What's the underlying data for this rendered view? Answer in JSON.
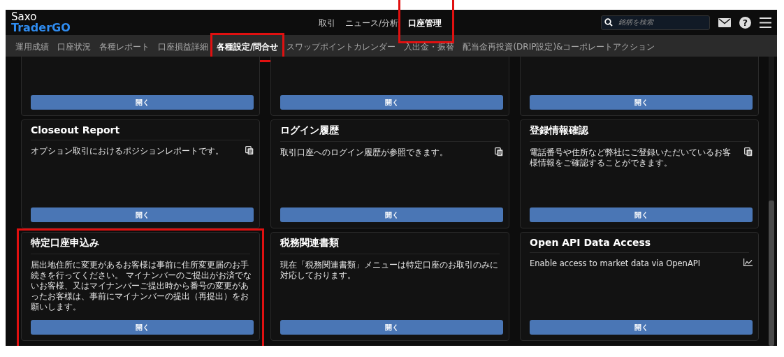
{
  "header": {
    "logo": {
      "line_1": "Saxo",
      "line_2": "TraderGO"
    },
    "nav": [
      {
        "label": "取引",
        "selected": false,
        "highlighted": false
      },
      {
        "label": "ニュース/分析",
        "selected": false,
        "highlighted": false
      },
      {
        "label": "口座管理",
        "selected": true,
        "highlighted": true
      }
    ],
    "search": {
      "placeholder": "銘柄を検索"
    },
    "help_label": "?"
  },
  "subnav": [
    {
      "label": "運用成績",
      "selected": false,
      "highlighted": false
    },
    {
      "label": "口座状況",
      "selected": false,
      "highlighted": false
    },
    {
      "label": "各種レポート",
      "selected": false,
      "highlighted": false
    },
    {
      "label": "口座損益詳細",
      "selected": false,
      "highlighted": false
    },
    {
      "label": "各種設定/問合せ",
      "selected": true,
      "highlighted": true
    },
    {
      "label": "スワップポイントカレンダー",
      "selected": false,
      "highlighted": false
    },
    {
      "label": "入出金・振替",
      "selected": false,
      "highlighted": false
    },
    {
      "label": "配当金再投資(DRIP設定)&コーポレートアクション",
      "selected": false,
      "highlighted": false
    }
  ],
  "cards": [
    {
      "kind": "partial",
      "button": "開く",
      "highlighted": false
    },
    {
      "kind": "partial",
      "button": "開く",
      "highlighted": false
    },
    {
      "kind": "partial",
      "button": "開く",
      "highlighted": false
    },
    {
      "kind": "document",
      "title": "Closeout Report",
      "description": "オプション取引におけるポジションレポートです。",
      "button": "開く",
      "highlighted": false
    },
    {
      "kind": "document",
      "title": "ログイン履歴",
      "description": "取引口座へのログイン履歴が参照できます。",
      "button": "開く",
      "highlighted": false
    },
    {
      "kind": "document",
      "title": "登録情報確認",
      "description": "電話番号や住所など弊社にご登録いただいているお客様情報をご確認することができます。",
      "button": "開く",
      "highlighted": false
    },
    {
      "kind": "plain",
      "title": "特定口座申込み",
      "description": "届出地住所に変更があるお客様は事前に住所変更届のお手続きを行ってください。 マイナンバーのご提出がお済でないお客様、又はマイナンバーご提出時から番号の変更があったお客様は、事前にマイナンバーの提出（再提出）をお願いします。",
      "button": "開く",
      "highlighted": true
    },
    {
      "kind": "plain",
      "title": "税務関連書類",
      "description": "現在「税務関連書類」メニューは特定口座のお取引のみに対応しております。",
      "button": "開く",
      "highlighted": false
    },
    {
      "kind": "chart",
      "title": "Open API Data Access",
      "description": "Enable access to market data via OpenAPI",
      "button": "開く",
      "highlighted": false
    }
  ]
}
